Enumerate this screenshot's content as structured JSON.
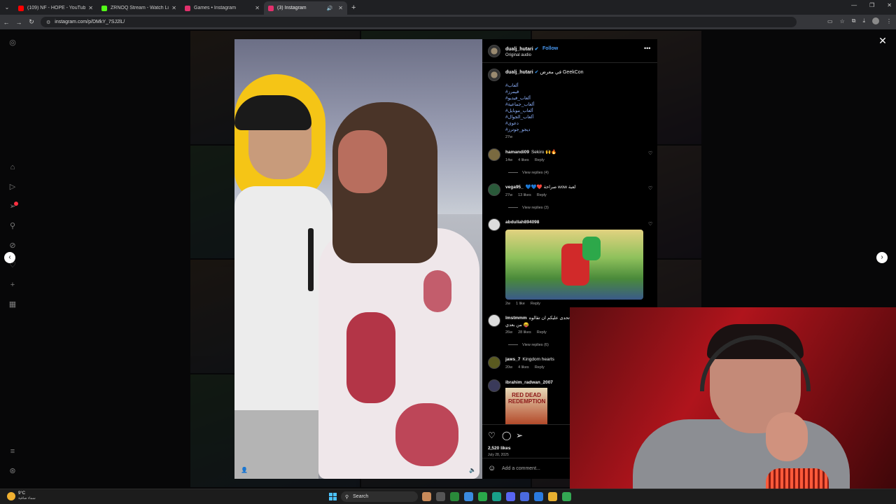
{
  "browser": {
    "tabs": [
      {
        "title": "(109) NF - HOPE - YouTube",
        "color": "#ff0000",
        "active": false
      },
      {
        "title": "ZRNOQ Stream - Watch Live o",
        "color": "#53fc18",
        "active": false
      },
      {
        "title": "Games • Instagram",
        "color": "#e1306c",
        "active": false
      },
      {
        "title": "(3) Instagram",
        "color": "#e1306c",
        "active": true
      }
    ],
    "url": "instagram.com/p/DMkY_7SJ2lL/"
  },
  "post": {
    "author": "dualj_hutari",
    "follow_label": "Follow",
    "audio": "Original audio",
    "caption_user": "dualj_hutari",
    "caption": "في معرض GeekCon",
    "hashtags": [
      "#ألعاب",
      "#قيمرز",
      "#ألعاب_فيديو",
      "#ألعاب_جماعية",
      "#ألعاب_موبايل",
      "#ألعاب_الجوال",
      "#دعوى",
      "#ديجو_جوترز"
    ],
    "caption_age": "27w",
    "likes": "2,520 likes",
    "date": "July 28, 2025",
    "add_comment_placeholder": "Add a comment..."
  },
  "comments": [
    {
      "user": "hamandi09",
      "text": "Sekiro 🙌🔥",
      "age": "14w",
      "likes": "4 likes",
      "reply": "Reply",
      "view_replies": "View replies (4)"
    },
    {
      "user": "vega95_",
      "text": "💙💙❤️ صراحة wow لعبة",
      "age": "27w",
      "likes": "13 likes",
      "reply": "Reply",
      "view_replies": "View replies (3)"
    },
    {
      "user": "abdullah894098",
      "text": "",
      "age": "2w",
      "likes": "1 like",
      "reply": "Reply",
      "view_replies": ""
    },
    {
      "user": "lmstmmm",
      "text": "أتحدى عليكم ان تقالوه",
      "text2": "من بعدي 😝",
      "age": "26w",
      "likes": "28 likes",
      "reply": "Reply",
      "view_replies": "View replies (6)"
    },
    {
      "user": "jaws_7",
      "text": "Kingdom hearts",
      "age": "20w",
      "likes": "4 likes",
      "reply": "Reply",
      "view_replies": ""
    },
    {
      "user": "ibrahim_radwan_2007",
      "text": "",
      "age": "",
      "likes": "",
      "reply": "",
      "view_replies": ""
    }
  ],
  "comment_image_text": "RED DEAD REDEMPTION",
  "taskbar": {
    "weather_temp": "9°C",
    "weather_desc": "سماء صافية",
    "search_label": "Search"
  },
  "icons": {
    "like": "heart-icon",
    "comment": "comment-icon",
    "share": "share-icon",
    "close": "close-icon",
    "more": "more-icon"
  }
}
